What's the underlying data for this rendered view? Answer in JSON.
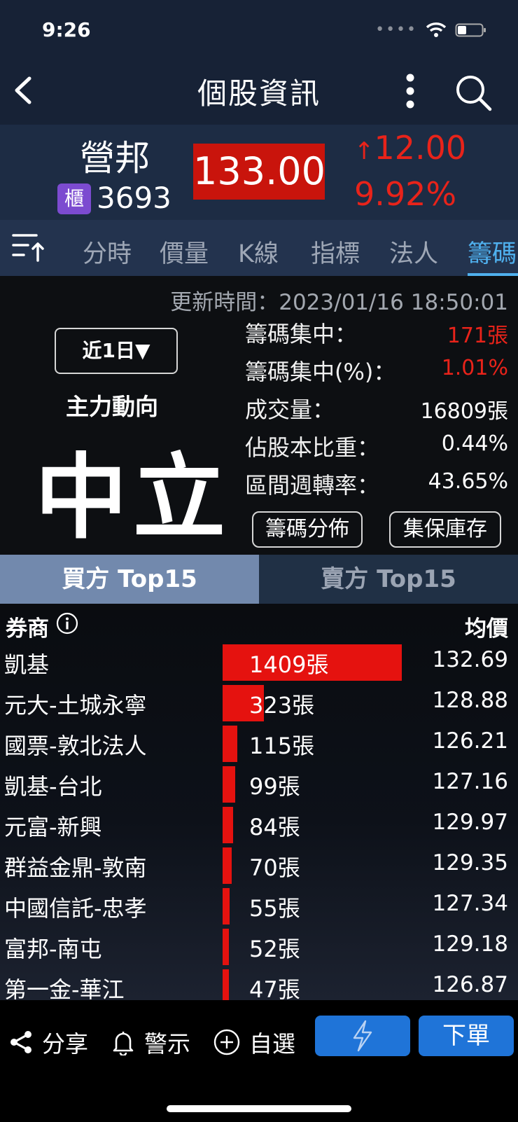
{
  "status_bar": {
    "time": "9:26"
  },
  "header": {
    "title": "個股資訊"
  },
  "quote": {
    "name": "營邦",
    "market_badge": "櫃",
    "code": "3693",
    "price": "133.00",
    "change": "12.00",
    "change_pct": "9.92%"
  },
  "tabs": [
    {
      "label": "分時"
    },
    {
      "label": "價量"
    },
    {
      "label": "K線"
    },
    {
      "label": "指標"
    },
    {
      "label": "法人"
    },
    {
      "label": "籌碼"
    }
  ],
  "active_tab": "籌碼",
  "chip": {
    "update_time": "更新時間：2023/01/16 18:50:01",
    "period": "近1日▼",
    "main_label": "主力動向",
    "main_value": "中立",
    "stats": [
      {
        "label": "籌碼集中：",
        "value": "171張"
      },
      {
        "label": "籌碼集中(%)：",
        "value": "1.01%"
      },
      {
        "label": "成交量：",
        "value": "16809張"
      },
      {
        "label": "佔股本比重：",
        "value": "0.44%"
      },
      {
        "label": "區間週轉率：",
        "value": "43.65%"
      }
    ],
    "dist_button": "籌碼分佈",
    "custody_button": "集保庫存"
  },
  "buy_sell_tabs": {
    "buy": "買方 Top15",
    "sell": "賣方 Top15"
  },
  "table": {
    "col_broker": "券商",
    "col_avg": "均價",
    "rows": [
      {
        "broker": "凱基",
        "qty": "1409張",
        "qty_value": 1409,
        "avg": "132.69"
      },
      {
        "broker": "元大-土城永寧",
        "qty": "323張",
        "qty_value": 323,
        "avg": "128.88"
      },
      {
        "broker": "國票-敦北法人",
        "qty": "115張",
        "qty_value": 115,
        "avg": "126.21"
      },
      {
        "broker": "凱基-台北",
        "qty": "99張",
        "qty_value": 99,
        "avg": "127.16"
      },
      {
        "broker": "元富-新興",
        "qty": "84張",
        "qty_value": 84,
        "avg": "129.97"
      },
      {
        "broker": "群益金鼎-敦南",
        "qty": "70張",
        "qty_value": 70,
        "avg": "129.35"
      },
      {
        "broker": "中國信託-忠孝",
        "qty": "55張",
        "qty_value": 55,
        "avg": "127.34"
      },
      {
        "broker": "富邦-南屯",
        "qty": "52張",
        "qty_value": 52,
        "avg": "129.18"
      },
      {
        "broker": "第一金-華江",
        "qty": "47張",
        "qty_value": 47,
        "avg": "126.87"
      }
    ]
  },
  "bottom_bar": {
    "share": "分享",
    "alert": "警示",
    "watchlist": "自選",
    "order": "下單"
  },
  "colors": {
    "up": "#e8231a",
    "accent": "#4fb0ee",
    "button": "#1f74d8",
    "badge": "#7c4bd0"
  }
}
